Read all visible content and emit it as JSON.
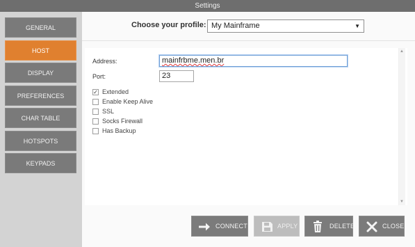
{
  "window": {
    "title": "Settings"
  },
  "sidebar": {
    "items": [
      {
        "label": "GENERAL",
        "active": false
      },
      {
        "label": "HOST",
        "active": true
      },
      {
        "label": "DISPLAY",
        "active": false
      },
      {
        "label": "PREFERENCES",
        "active": false
      },
      {
        "label": "CHAR TABLE",
        "active": false
      },
      {
        "label": "HOTSPOTS",
        "active": false
      },
      {
        "label": "KEYPADS",
        "active": false
      }
    ]
  },
  "profile": {
    "label": "Choose your profile:",
    "selected": "My Mainframe"
  },
  "host": {
    "address_label": "Address:",
    "address_value": "mainfrbme.men.br",
    "port_label": "Port:",
    "port_value": "23",
    "options": [
      {
        "label": "Extended",
        "checked": true
      },
      {
        "label": "Enable Keep Alive",
        "checked": false
      },
      {
        "label": "SSL",
        "checked": false
      },
      {
        "label": "Socks Firewall",
        "checked": false
      },
      {
        "label": "Has Backup",
        "checked": false
      }
    ]
  },
  "buttons": {
    "connect": "CONNECT",
    "apply": "APPLY",
    "delete": "DELETE",
    "close": "CLOSE"
  },
  "colors": {
    "accent": "#e0802f",
    "nav_bg": "#7a7a7a",
    "titlebar": "#6e6e6e"
  }
}
